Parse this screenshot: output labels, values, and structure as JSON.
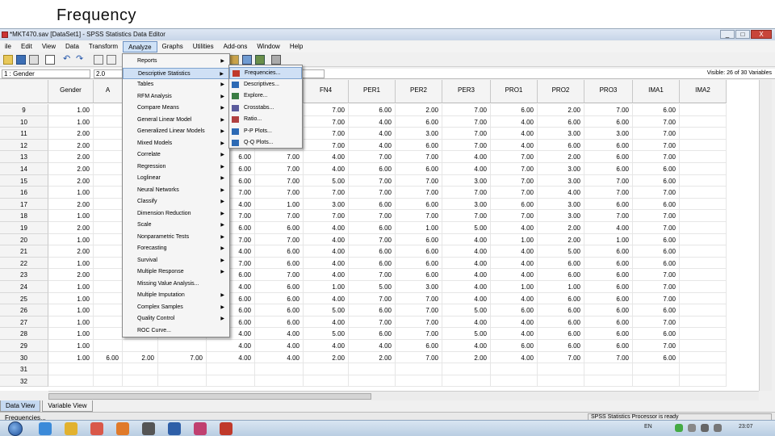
{
  "slide_title": "Frequency",
  "window": {
    "title": "*MKT470.sav [DataSet1] - SPSS Statistics Data Editor",
    "buttons": [
      "_",
      "□",
      "X"
    ]
  },
  "menubar": [
    "ile",
    "Edit",
    "View",
    "Data",
    "Transform",
    "Analyze",
    "Graphs",
    "Utilities",
    "Add-ons",
    "Window",
    "Help"
  ],
  "active_menu": "Analyze",
  "cell_editor": {
    "name": "1 : Gender",
    "value": "2.0",
    "visible": "Visible: 26 of 30 Variables"
  },
  "columns": [
    "Gender",
    "A",
    "",
    "",
    "FV2",
    "FN4",
    "PER1",
    "PER2",
    "PER3",
    "PRO1",
    "PRO2",
    "PRO3",
    "IMA1",
    "IMA2"
  ],
  "rows": [
    {
      "n": "9",
      "g": "1.00",
      "fv2": "6.00",
      "fn4": "2.00",
      "p1": "7.00",
      "p2": "6.00",
      "p3": "2.00",
      "r1": "7.00",
      "r2": "6.00",
      "r3": "2.00",
      "i1": "7.00",
      "i2": "6.00"
    },
    {
      "n": "10",
      "g": "1.00",
      "fv2": "6.00",
      "fn4": "7.00",
      "p1": "7.00",
      "p2": "4.00",
      "p3": "6.00",
      "r1": "7.00",
      "r2": "4.00",
      "r3": "6.00",
      "i1": "6.00",
      "i2": "7.00"
    },
    {
      "n": "11",
      "g": "2.00",
      "fv2": "6.00",
      "fn4": "7.00",
      "p1": "7.00",
      "p2": "4.00",
      "p3": "3.00",
      "r1": "7.00",
      "r2": "4.00",
      "r3": "3.00",
      "i1": "3.00",
      "i2": "7.00"
    },
    {
      "n": "12",
      "g": "2.00",
      "fv2": "6.00",
      "fn4": "7.00",
      "p1": "7.00",
      "p2": "4.00",
      "p3": "6.00",
      "r1": "7.00",
      "r2": "4.00",
      "r3": "6.00",
      "i1": "6.00",
      "i2": "7.00"
    },
    {
      "n": "13",
      "g": "2.00",
      "fv2": "6.00",
      "fn4": "7.00",
      "p1": "4.00",
      "p2": "7.00",
      "p3": "7.00",
      "r1": "4.00",
      "r2": "7.00",
      "r3": "2.00",
      "i1": "6.00",
      "i2": "7.00"
    },
    {
      "n": "14",
      "g": "2.00",
      "fv2": "6.00",
      "fn4": "7.00",
      "p1": "4.00",
      "p2": "6.00",
      "p3": "6.00",
      "r1": "4.00",
      "r2": "7.00",
      "r3": "3.00",
      "i1": "6.00",
      "i2": "6.00"
    },
    {
      "n": "15",
      "g": "2.00",
      "fv2": "6.00",
      "fn4": "7.00",
      "p1": "5.00",
      "p2": "7.00",
      "p3": "7.00",
      "r1": "3.00",
      "r2": "7.00",
      "r3": "3.00",
      "i1": "7.00",
      "i2": "6.00"
    },
    {
      "n": "16",
      "g": "1.00",
      "fv2": "7.00",
      "fn4": "7.00",
      "p1": "7.00",
      "p2": "7.00",
      "p3": "7.00",
      "r1": "7.00",
      "r2": "7.00",
      "r3": "4.00",
      "i1": "7.00",
      "i2": "7.00"
    },
    {
      "n": "17",
      "g": "2.00",
      "fv2": "4.00",
      "fn4": "1.00",
      "p1": "3.00",
      "p2": "6.00",
      "p3": "6.00",
      "r1": "3.00",
      "r2": "6.00",
      "r3": "3.00",
      "i1": "6.00",
      "i2": "6.00"
    },
    {
      "n": "18",
      "g": "1.00",
      "fv2": "7.00",
      "fn4": "7.00",
      "p1": "7.00",
      "p2": "7.00",
      "p3": "7.00",
      "r1": "7.00",
      "r2": "7.00",
      "r3": "3.00",
      "i1": "7.00",
      "i2": "7.00"
    },
    {
      "n": "19",
      "g": "2.00",
      "fv2": "6.00",
      "fn4": "6.00",
      "p1": "4.00",
      "p2": "6.00",
      "p3": "1.00",
      "r1": "5.00",
      "r2": "4.00",
      "r3": "2.00",
      "i1": "4.00",
      "i2": "7.00"
    },
    {
      "n": "20",
      "g": "1.00",
      "fv2": "7.00",
      "fn4": "7.00",
      "p1": "4.00",
      "p2": "7.00",
      "p3": "6.00",
      "r1": "4.00",
      "r2": "1.00",
      "r3": "2.00",
      "i1": "1.00",
      "i2": "6.00"
    },
    {
      "n": "21",
      "g": "2.00",
      "fv2": "4.00",
      "fn4": "6.00",
      "p1": "4.00",
      "p2": "6.00",
      "p3": "6.00",
      "r1": "4.00",
      "r2": "4.00",
      "r3": "5.00",
      "i1": "6.00",
      "i2": "6.00"
    },
    {
      "n": "22",
      "g": "1.00",
      "fv2": "7.00",
      "fn4": "6.00",
      "p1": "4.00",
      "p2": "6.00",
      "p3": "6.00",
      "r1": "4.00",
      "r2": "4.00",
      "r3": "6.00",
      "i1": "6.00",
      "i2": "6.00"
    },
    {
      "n": "23",
      "g": "2.00",
      "fv2": "6.00",
      "fn4": "7.00",
      "p1": "4.00",
      "p2": "7.00",
      "p3": "6.00",
      "r1": "4.00",
      "r2": "4.00",
      "r3": "6.00",
      "i1": "6.00",
      "i2": "7.00"
    },
    {
      "n": "24",
      "g": "1.00",
      "fv2": "4.00",
      "fn4": "6.00",
      "p1": "1.00",
      "p2": "5.00",
      "p3": "3.00",
      "r1": "4.00",
      "r2": "1.00",
      "r3": "1.00",
      "i1": "6.00",
      "i2": "7.00"
    },
    {
      "n": "25",
      "g": "1.00",
      "fv2": "6.00",
      "fn4": "6.00",
      "p1": "4.00",
      "p2": "7.00",
      "p3": "7.00",
      "r1": "4.00",
      "r2": "4.00",
      "r3": "6.00",
      "i1": "6.00",
      "i2": "7.00"
    },
    {
      "n": "26",
      "g": "1.00",
      "fv2": "6.00",
      "fn4": "6.00",
      "p1": "5.00",
      "p2": "6.00",
      "p3": "7.00",
      "r1": "5.00",
      "r2": "6.00",
      "r3": "6.00",
      "i1": "6.00",
      "i2": "6.00"
    },
    {
      "n": "27",
      "g": "1.00",
      "fv2": "6.00",
      "fn4": "6.00",
      "p1": "4.00",
      "p2": "7.00",
      "p3": "7.00",
      "r1": "4.00",
      "r2": "4.00",
      "r3": "6.00",
      "i1": "6.00",
      "i2": "7.00"
    },
    {
      "n": "28",
      "g": "1.00",
      "fv2": "4.00",
      "fn4": "4.00",
      "p1": "5.00",
      "p2": "6.00",
      "p3": "7.00",
      "r1": "5.00",
      "r2": "4.00",
      "r3": "6.00",
      "i1": "6.00",
      "i2": "6.00"
    },
    {
      "n": "29",
      "g": "1.00",
      "fv2": "4.00",
      "fn4": "4.00",
      "p1": "4.00",
      "p2": "4.00",
      "p3": "6.00",
      "r1": "4.00",
      "r2": "6.00",
      "r3": "6.00",
      "i1": "6.00",
      "i2": "7.00"
    },
    {
      "n": "30",
      "g": "1.00",
      "fv2": "4.00",
      "fn4": "4.00",
      "p1": "2.00",
      "p2": "2.00",
      "p3": "7.00",
      "r1": "2.00",
      "r2": "4.00",
      "r3": "7.00",
      "i1": "7.00",
      "i2": "6.00"
    },
    {
      "n": "31",
      "g": "",
      "fv2": "",
      "fn4": "",
      "p1": "",
      "p2": "",
      "p3": "",
      "r1": "",
      "r2": "",
      "r3": "",
      "i1": "",
      "i2": ""
    },
    {
      "n": "32",
      "g": "",
      "fv2": "",
      "fn4": "",
      "p1": "",
      "p2": "",
      "p3": "",
      "r1": "",
      "r2": "",
      "r3": "",
      "i1": "",
      "i2": ""
    }
  ],
  "row30_extra": {
    "c3": "6.00",
    "c4": "2.00",
    "c5": "7.00"
  },
  "analyze_menu": [
    {
      "label": "Reports",
      "arrow": true
    },
    {
      "label": "Descriptive Statistics",
      "arrow": true,
      "highlight": true
    },
    {
      "label": "Tables",
      "arrow": true
    },
    {
      "label": "RFM Analysis",
      "arrow": true
    },
    {
      "label": "Compare Means",
      "arrow": true
    },
    {
      "label": "General Linear Model",
      "arrow": true
    },
    {
      "label": "Generalized Linear Models",
      "arrow": true
    },
    {
      "label": "Mixed Models",
      "arrow": true
    },
    {
      "label": "Correlate",
      "arrow": true
    },
    {
      "label": "Regression",
      "arrow": true
    },
    {
      "label": "Loglinear",
      "arrow": true
    },
    {
      "label": "Neural Networks",
      "arrow": true
    },
    {
      "label": "Classify",
      "arrow": true
    },
    {
      "label": "Dimension Reduction",
      "arrow": true
    },
    {
      "label": "Scale",
      "arrow": true
    },
    {
      "label": "Nonparametric Tests",
      "arrow": true
    },
    {
      "label": "Forecasting",
      "arrow": true
    },
    {
      "label": "Survival",
      "arrow": true
    },
    {
      "label": "Multiple Response",
      "arrow": true
    },
    {
      "label": "Missing Value Analysis...",
      "arrow": false
    },
    {
      "label": "Multiple Imputation",
      "arrow": true
    },
    {
      "label": "Complex Samples",
      "arrow": true
    },
    {
      "label": "Quality Control",
      "arrow": true
    },
    {
      "label": "ROC Curve...",
      "arrow": false
    }
  ],
  "descriptive_submenu": [
    {
      "label": "Frequencies...",
      "icon": "123",
      "highlight": true
    },
    {
      "label": "Descriptives...",
      "icon": ""
    },
    {
      "label": "Explore...",
      "icon": ""
    },
    {
      "label": "Crosstabs...",
      "icon": ""
    },
    {
      "label": "Ratio...",
      "icon": "1/2"
    },
    {
      "label": "P-P Plots...",
      "icon": ""
    },
    {
      "label": "Q-Q Plots...",
      "icon": ""
    }
  ],
  "tabs": [
    "Data View",
    "Variable View"
  ],
  "status": {
    "left": "Frequencies...",
    "right": "SPSS Statistics Processor is ready"
  },
  "taskbar": {
    "lang": "EN",
    "time": "23:07"
  },
  "colors": {
    "menu_highlight": "#cfe0f5",
    "title_gradient": "#c7d5e8",
    "taskbar": "#b9cde2"
  }
}
